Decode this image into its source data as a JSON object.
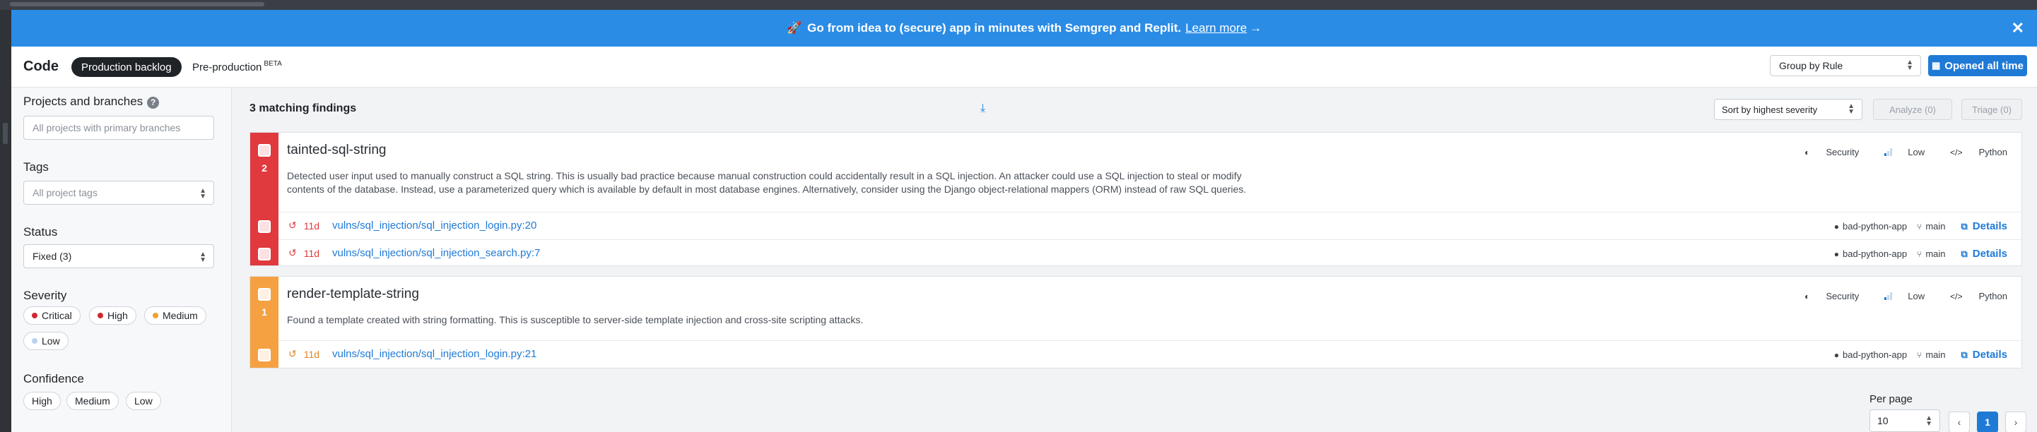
{
  "banner": {
    "text": "Go from idea to (secure) app in minutes with Semgrep and Replit.",
    "link": "Learn more",
    "arrow": "→",
    "close": "✕"
  },
  "header": {
    "title": "Code",
    "tabs": [
      {
        "label": "Production backlog",
        "active": true
      },
      {
        "label": "Pre-production",
        "badge": "BETA",
        "active": false
      }
    ],
    "group_by": "Group by Rule",
    "opened_filter": "Opened all time"
  },
  "sidebar": {
    "projects": {
      "label": "Projects and branches",
      "help": "?",
      "placeholder": "All projects with primary branches"
    },
    "tags": {
      "label": "Tags",
      "placeholder": "All project tags"
    },
    "status": {
      "label": "Status",
      "value": "Fixed (3)"
    },
    "severity": {
      "label": "Severity",
      "options": [
        "Critical",
        "High",
        "Medium",
        "Low"
      ]
    },
    "confidence": {
      "label": "Confidence",
      "options": [
        "High",
        "Medium",
        "Low"
      ]
    }
  },
  "main": {
    "count_text": "3 matching findings",
    "sort": "Sort by highest severity",
    "analyze": "Analyze (0)",
    "triage": "Triage (0)",
    "findings": [
      {
        "rule": "tainted-sql-string",
        "count": "2",
        "description_1": "Detected user input used to manually construct a SQL string. This is usually bad practice because manual construction could accidentally result in a SQL injection. An attacker could use a SQL injection to steal or modify",
        "description_2": "contents of the database. Instead, use a parameterized query which is available by default in most database engines. Alternatively, consider using the Django object-relational mappers (ORM) instead of raw SQL queries.",
        "category": "Security",
        "confidence": "Low",
        "language": "Python",
        "rows": [
          {
            "age": "11d",
            "path": "vulns/sql_injection/sql_injection_login.py:20",
            "repo": "bad-python-app",
            "branch": "main",
            "details": "Details"
          },
          {
            "age": "11d",
            "path": "vulns/sql_injection/sql_injection_search.py:7",
            "repo": "bad-python-app",
            "branch": "main",
            "details": "Details"
          }
        ]
      },
      {
        "rule": "render-template-string",
        "count": "1",
        "description_1": "Found a template created with string formatting. This is susceptible to server-side template injection and cross-site scripting attacks.",
        "category": "Security",
        "confidence": "Low",
        "language": "Python",
        "rows": [
          {
            "age": "11d",
            "path": "vulns/sql_injection/sql_injection_login.py:21",
            "repo": "bad-python-app",
            "branch": "main",
            "details": "Details"
          }
        ]
      }
    ],
    "pagination": {
      "per_page_label": "Per page",
      "per_page": "10",
      "prev": "‹",
      "current": "1",
      "next": "›"
    }
  },
  "colors": {
    "banner": "#2b8ce6",
    "accent": "#1f7ad6",
    "critical": "#e0393e",
    "high": "#e0393e",
    "medium": "#f5a142",
    "low": "#b8d4f0"
  }
}
